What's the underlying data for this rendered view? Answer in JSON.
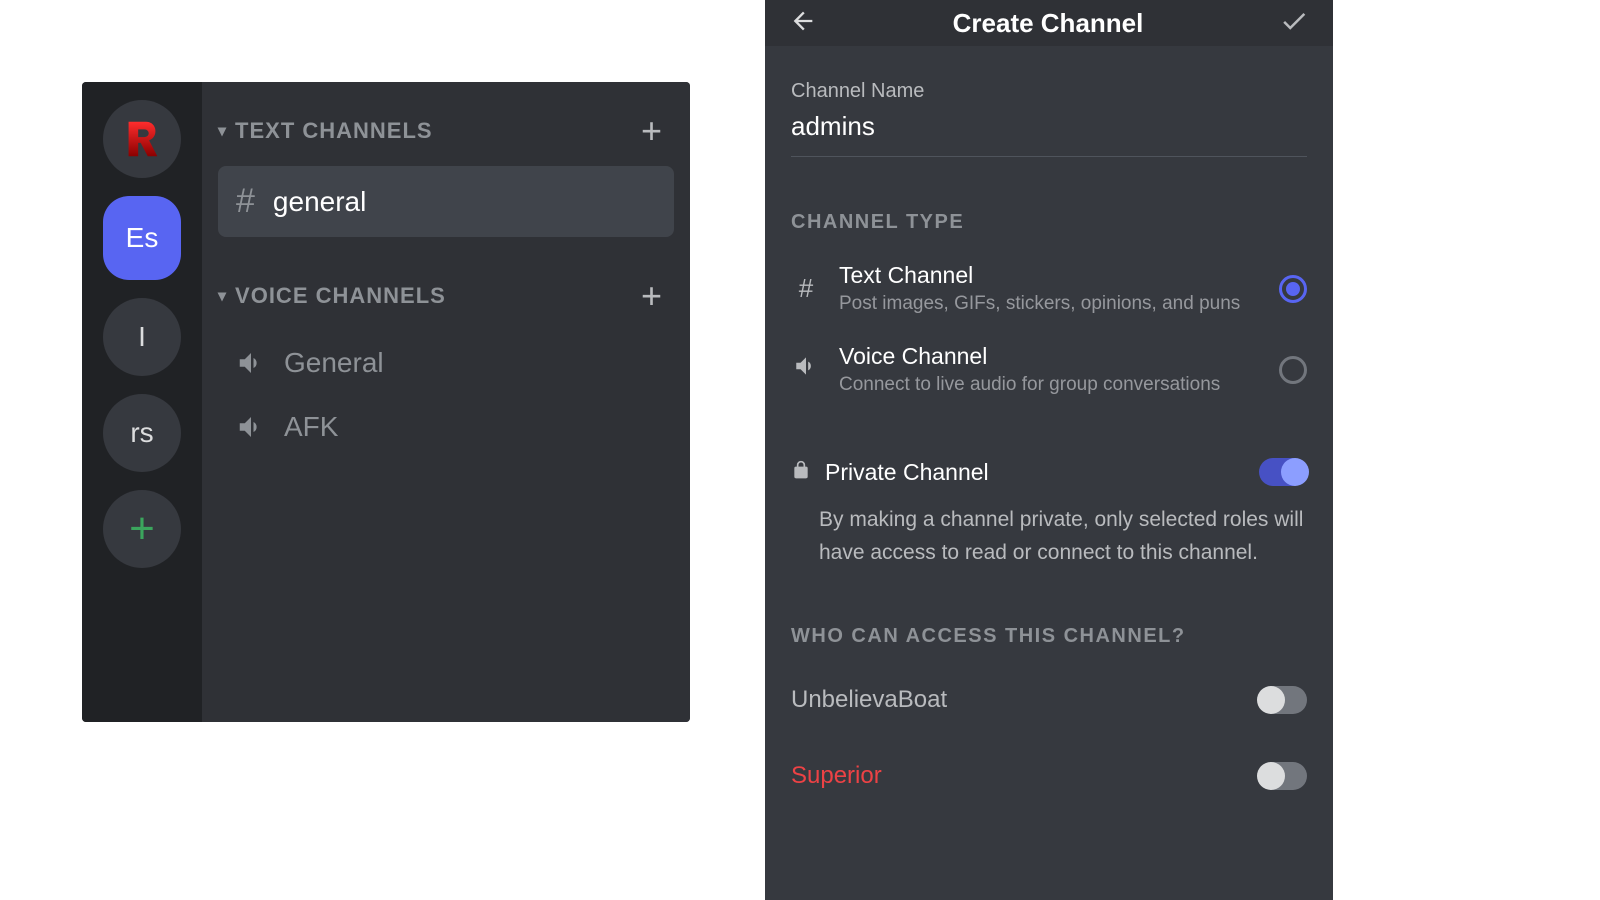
{
  "left": {
    "servers": [
      {
        "label": "R",
        "kind": "r"
      },
      {
        "label": "Es",
        "kind": "es"
      },
      {
        "label": "I",
        "kind": "plain"
      },
      {
        "label": "rs",
        "kind": "plain"
      },
      {
        "label": "+",
        "kind": "add"
      }
    ],
    "text_cat": "TEXT CHANNELS",
    "voice_cat": "VOICE CHANNELS",
    "text_channels": [
      "general"
    ],
    "voice_channels": [
      "General",
      "AFK"
    ]
  },
  "right": {
    "title": "Create Channel",
    "name_label": "Channel Name",
    "name_value": "admins",
    "type_label": "CHANNEL TYPE",
    "types": [
      {
        "title": "Text Channel",
        "desc": "Post images, GIFs, stickers, opinions, and puns",
        "selected": true
      },
      {
        "title": "Voice Channel",
        "desc": "Connect to live audio for group conversations",
        "selected": false
      }
    ],
    "private_title": "Private Channel",
    "private_on": true,
    "private_desc": "By making a channel private, only selected roles will have access to read or connect to this channel.",
    "access_label": "WHO CAN ACCESS THIS CHANNEL?",
    "access": [
      {
        "name": "UnbelievaBoat",
        "on": false,
        "style": ""
      },
      {
        "name": "Superior",
        "on": false,
        "style": "superior"
      }
    ]
  }
}
